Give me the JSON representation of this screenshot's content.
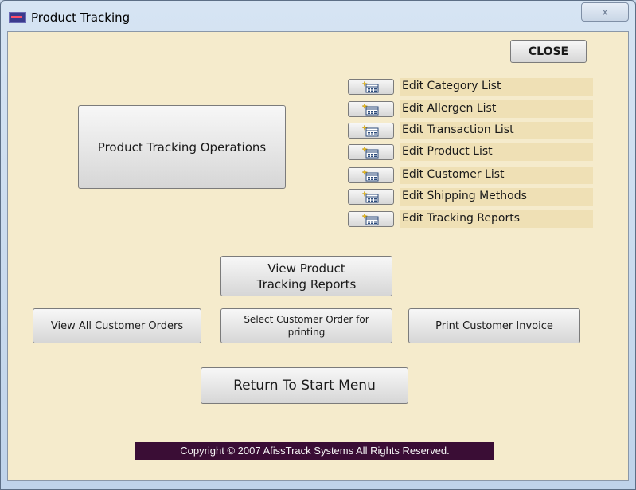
{
  "window": {
    "title": "Product Tracking",
    "close_glyph": "x"
  },
  "buttons": {
    "close": "CLOSE",
    "product_tracking_operations": "Product Tracking Operations",
    "view_reports_line1": "View Product",
    "view_reports_line2": "Tracking Reports",
    "view_all_orders": "View All Customer Orders",
    "select_order_line1": "Select  Customer Order for",
    "select_order_line2": "printing",
    "print_invoice": "Print Customer Invoice",
    "return_start": "Return To Start Menu"
  },
  "edit_lists": [
    {
      "label": "Edit Category List"
    },
    {
      "label": "Edit Allergen List"
    },
    {
      "label": "Edit Transaction List"
    },
    {
      "label": "Edit Product List"
    },
    {
      "label": "Edit Customer List"
    },
    {
      "label": "Edit Shipping Methods"
    },
    {
      "label": "Edit Tracking Reports"
    }
  ],
  "footer": {
    "copyright": "Copyright © 2007 AfissTrack Systems All Rights Reserved."
  },
  "colors": {
    "form_background": "#f5ebcc",
    "row_highlight": "#efe0b5",
    "copyright_bg": "#3a0d35"
  },
  "icons": {
    "edit_button_icon": "form-wizard-icon",
    "app_icon": "app-logo-icon"
  }
}
